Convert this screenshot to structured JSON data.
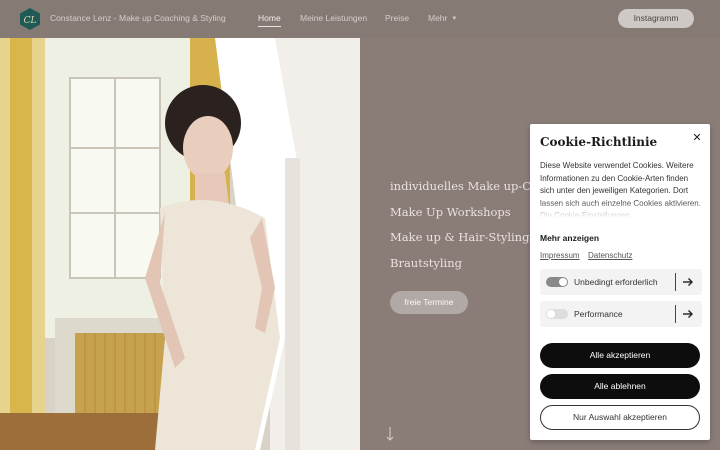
{
  "header": {
    "brand": "Constance Lenz - Make up Coaching & Styling",
    "logo_letters": "CL",
    "nav": [
      {
        "label": "Home",
        "active": true
      },
      {
        "label": "Meine Leistungen",
        "active": false
      },
      {
        "label": "Preise",
        "active": false
      },
      {
        "label": "Mehr",
        "active": false
      }
    ],
    "instagram_label": "Instagramm"
  },
  "hero": {
    "lines": [
      "individuelles Make up-Coaching",
      "Make Up Workshops",
      "Make up & Hair-Styling",
      "Brautstyling"
    ],
    "cta_label": "freie Termine"
  },
  "cookie": {
    "title": "Cookie-Richtlinie",
    "description": "Diese Website verwendet Cookies. Weitere Informationen zu den Cookie-Arten finden sich unter den jeweiligen Kategorien. Dort lassen sich auch einzelne Cookies aktivieren. Die Cookie-Einstellungen",
    "more_label": "Mehr anzeigen",
    "links": [
      "Impressum",
      "Datenschutz"
    ],
    "categories": [
      {
        "label": "Unbedingt erforderlich",
        "enabled": true
      },
      {
        "label": "Performance",
        "enabled": false
      }
    ],
    "accept_all": "Alle akzeptieren",
    "reject_all": "Alle ablehnen",
    "accept_selection": "Nur Auswahl akzeptieren"
  },
  "colors": {
    "page_bg": "#8a7d78",
    "logo_teal": "#1f5a56",
    "button_dark": "#0d0d0d",
    "toggle_on": "#8a8a8a",
    "toggle_off": "#dddddd"
  }
}
